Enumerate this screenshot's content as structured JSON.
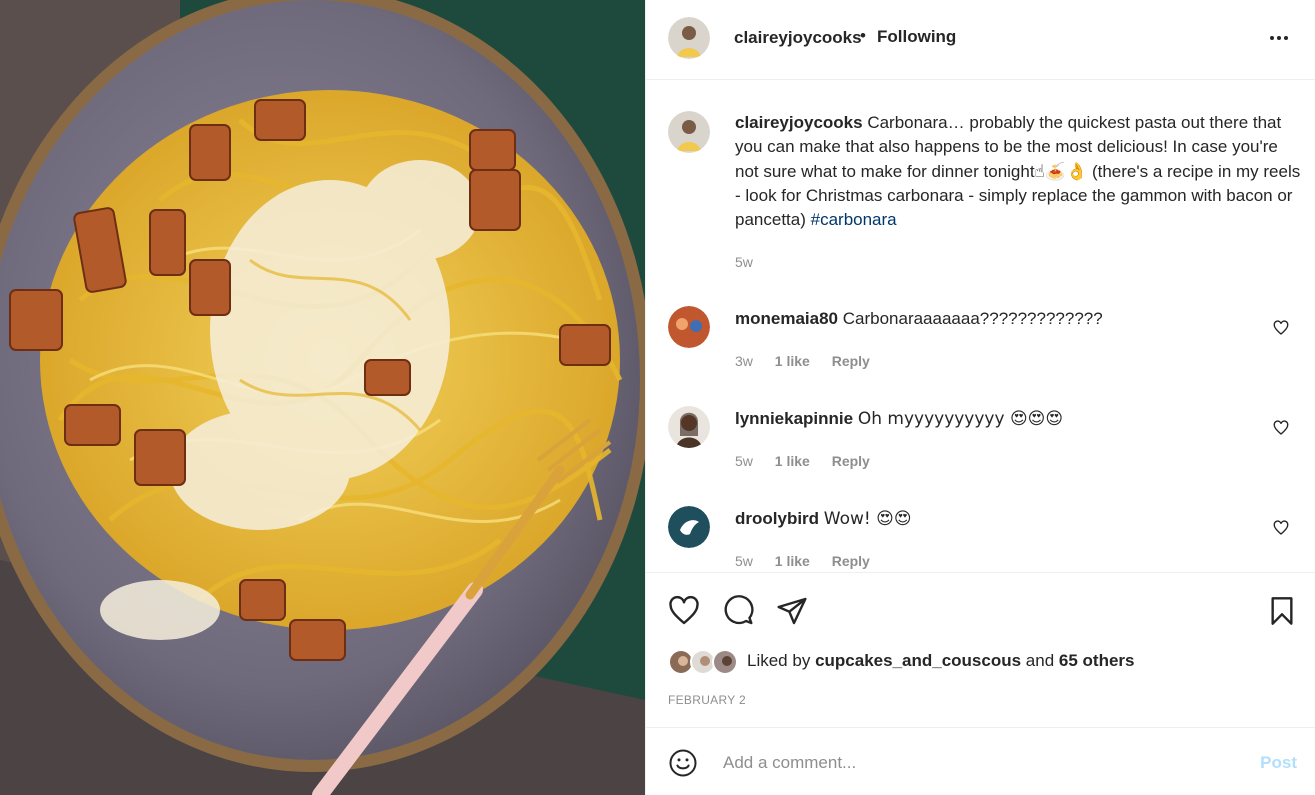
{
  "post": {
    "author": "claireyjoycooks",
    "follow_dot": "•",
    "follow_status": "Following"
  },
  "caption": {
    "username": "claireyjoycooks",
    "text": "Carbonara… probably the quickest pasta out there that you can make that also happens to be the most delicious! In case you're not sure what to make for dinner tonight☝🍝👌 (there's a recipe in my reels - look for Christmas carbonara - simply replace the gammon with bacon or pancetta)",
    "hashtag": "#carbonara",
    "time": "5w"
  },
  "comments": [
    {
      "username": "monemaia80",
      "text": "Carbonaraaaaaaa?????????????",
      "time": "3w",
      "likes": "1 like",
      "reply": "Reply",
      "avatar_color": "#c0572e"
    },
    {
      "username": "lynniekapinnie",
      "text": "Oh myyyyyyyyyy 😍😍😍",
      "time": "5w",
      "likes": "1 like",
      "reply": "Reply",
      "avatar_color": "#6b4a3a"
    },
    {
      "username": "droolybird",
      "text": "Wow! 😍😍",
      "time": "5w",
      "likes": "1 like",
      "reply": "Reply",
      "avatar_color": "#1f4f5c"
    }
  ],
  "likes": {
    "prefix": "Liked by",
    "user": "cupcakes_and_couscous",
    "connector": "and",
    "others": "65 others"
  },
  "date": "FEBRUARY 2",
  "comment_input": {
    "placeholder": "Add a comment...",
    "post_label": "Post"
  },
  "icons": {
    "more": "more-options-icon",
    "like": "heart-icon",
    "comment": "comment-icon",
    "share": "share-icon",
    "save": "bookmark-icon",
    "emoji": "smiley-icon"
  },
  "colors": {
    "text": "#262626",
    "secondary": "#8e8e8e",
    "hashtag": "#00376b",
    "post_button_disabled": "#b2dffc"
  }
}
